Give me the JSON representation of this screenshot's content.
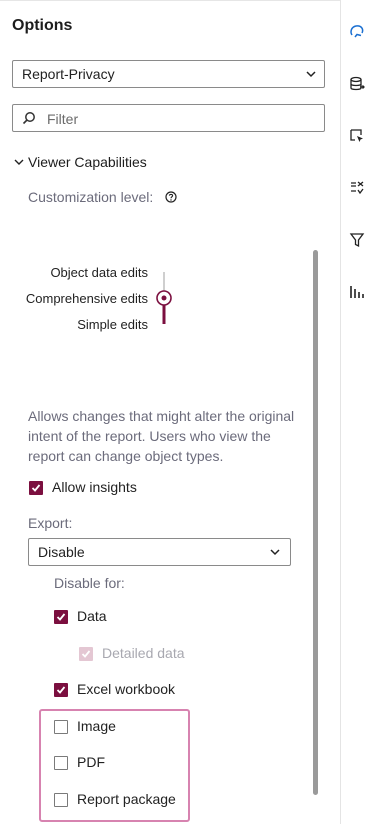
{
  "panel": {
    "title": "Options",
    "object_select": {
      "value": "Report-Privacy"
    },
    "filter": {
      "placeholder": "Filter"
    },
    "section": {
      "title": "Viewer Capabilities",
      "customization_label": "Customization level:",
      "levels": [
        {
          "label": "Object data edits",
          "selected": false
        },
        {
          "label": "Comprehensive edits",
          "selected": true
        },
        {
          "label": "Simple edits",
          "selected": false
        }
      ],
      "description": "Allows changes that might alter the original intent of the report. Users who view the report can change object types.",
      "allow_insights": {
        "label": "Allow insights",
        "checked": true
      },
      "export": {
        "label": "Export:",
        "value": "Disable",
        "disable_for_label": "Disable for:",
        "items": [
          {
            "label": "Data",
            "checked": true,
            "disabled": false
          },
          {
            "label": "Detailed data",
            "checked": true,
            "disabled": true
          },
          {
            "label": "Excel workbook",
            "checked": true,
            "disabled": false
          },
          {
            "label": "Image",
            "checked": false,
            "disabled": false
          },
          {
            "label": "PDF",
            "checked": false,
            "disabled": false
          },
          {
            "label": "Report package",
            "checked": false,
            "disabled": false
          }
        ]
      }
    }
  },
  "rail": {
    "icons": [
      "options-icon",
      "data-icon",
      "actions-icon",
      "rules-icon",
      "filters-icon",
      "ranks-icon"
    ]
  },
  "colors": {
    "accent": "#7b0f3f",
    "highlight": "#d783b0",
    "muted_text": "#6b6b7b"
  }
}
